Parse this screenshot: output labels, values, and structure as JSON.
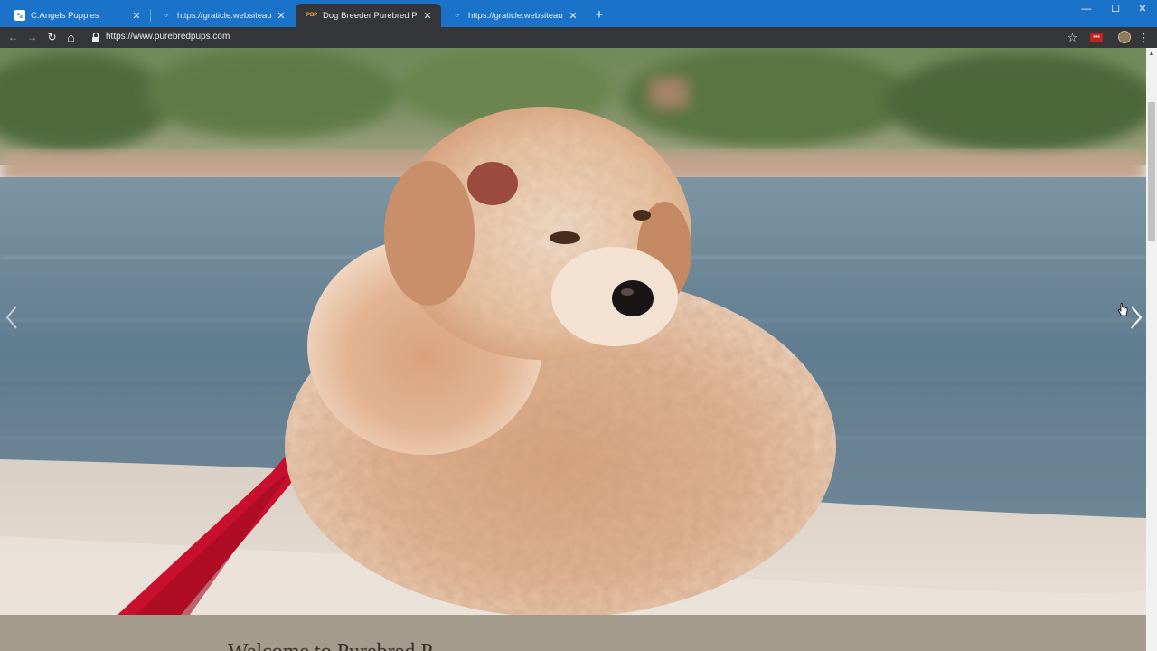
{
  "browser": {
    "tabs": [
      {
        "title": "C.Angels Puppies",
        "favicon": "paw-icon",
        "active": false
      },
      {
        "title": "https://graticle.websiteauditserv",
        "favicon": "loading-swirl-icon",
        "active": false
      },
      {
        "title": "Dog Breeder Purebred Puppies F",
        "favicon": "pbp-logo-icon",
        "favicon_text": "PBP",
        "active": true
      },
      {
        "title": "https://graticle.websiteauditserv",
        "favicon": "loading-swirl-icon",
        "active": false
      }
    ],
    "new_tab_label": "+",
    "window_controls": {
      "minimize": "—",
      "maximize": "☐",
      "close": "✕"
    },
    "toolbar": {
      "back": "←",
      "forward": "→",
      "reload": "↻",
      "home": "⌂",
      "url": "https://www.purebredpups.com",
      "bookmark": "☆",
      "extension_badge": "•••",
      "menu": "⋮"
    }
  },
  "page": {
    "hero_alt_icon": "curly-puppy-on-boat-image",
    "welcome_heading": "Welcome to Purebred P"
  },
  "colors": {
    "tab_strip": "#1a73c9",
    "toolbar": "#35363a",
    "below_hero": "#a39b8c",
    "leash": "#c8102e"
  }
}
